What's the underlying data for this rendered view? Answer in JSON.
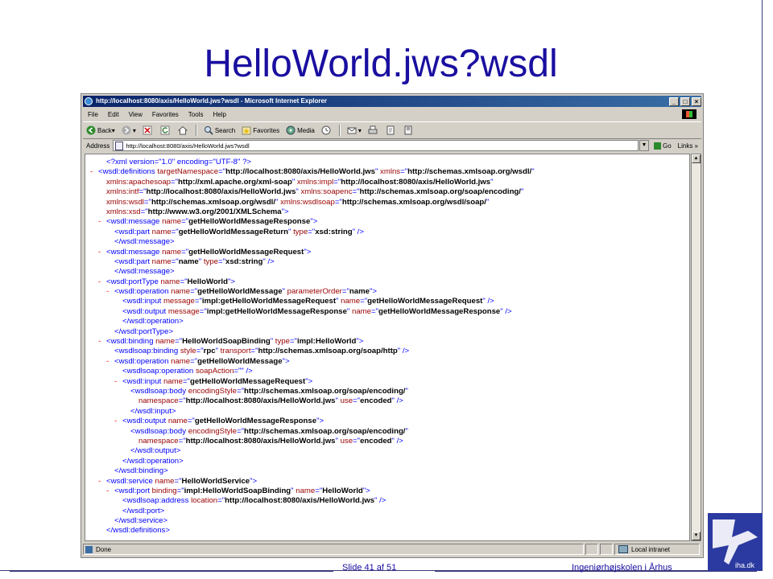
{
  "slide": {
    "title": "HelloWorld.jws?wsdl",
    "slide_number": "Slide 41 af  51",
    "organization": "Ingeniørhøjskolen i Århus",
    "logo_text": "iha.dk"
  },
  "browser": {
    "window_title": "http://localhost:8080/axis/HelloWorld.jws?wsdl - Microsoft Internet Explorer",
    "menu": [
      "File",
      "Edit",
      "View",
      "Favorites",
      "Tools",
      "Help"
    ],
    "toolbar": {
      "back": "Back",
      "search": "Search",
      "favorites": "Favorites",
      "media": "Media"
    },
    "address_label": "Address",
    "address_value": "http://localhost:8080/axis/HelloWorld.jws?wsdl",
    "go_label": "Go",
    "links_label": "Links",
    "status_text": "Done",
    "zone_text": "Local intranet"
  },
  "xml_lines": [
    {
      "indent": 1,
      "dash": false,
      "parts": [
        [
          "t",
          "<?xml version=\"1.0\" encoding=\"UTF-8\" ?>"
        ]
      ]
    },
    {
      "indent": 0,
      "dash": true,
      "parts": [
        [
          "t",
          "<wsdl:definitions "
        ],
        [
          "n",
          "targetNamespace"
        ],
        [
          "t",
          "=\""
        ],
        [
          "v",
          "http://localhost:8080/axis/HelloWorld.jws"
        ],
        [
          "t",
          "\" "
        ],
        [
          "n",
          "xmlns"
        ],
        [
          "t",
          "=\""
        ],
        [
          "v",
          "http://schemas.xmlsoap.org/wsdl/"
        ],
        [
          "t",
          "\""
        ]
      ]
    },
    {
      "indent": 1,
      "dash": false,
      "parts": [
        [
          "n",
          "xmlns:apachesoap"
        ],
        [
          "t",
          "=\""
        ],
        [
          "v",
          "http://xml.apache.org/xml-soap"
        ],
        [
          "t",
          "\" "
        ],
        [
          "n",
          "xmlns:impl"
        ],
        [
          "t",
          "=\""
        ],
        [
          "v",
          "http://localhost:8080/axis/HelloWorld.jws"
        ],
        [
          "t",
          "\""
        ]
      ]
    },
    {
      "indent": 1,
      "dash": false,
      "parts": [
        [
          "n",
          "xmlns:intf"
        ],
        [
          "t",
          "=\""
        ],
        [
          "v",
          "http://localhost:8080/axis/HelloWorld.jws"
        ],
        [
          "t",
          "\" "
        ],
        [
          "n",
          "xmlns:soapenc"
        ],
        [
          "t",
          "=\""
        ],
        [
          "v",
          "http://schemas.xmlsoap.org/soap/encoding/"
        ],
        [
          "t",
          "\""
        ]
      ]
    },
    {
      "indent": 1,
      "dash": false,
      "parts": [
        [
          "n",
          "xmlns:wsdl"
        ],
        [
          "t",
          "=\""
        ],
        [
          "v",
          "http://schemas.xmlsoap.org/wsdl/"
        ],
        [
          "t",
          "\" "
        ],
        [
          "n",
          "xmlns:wsdlsoap"
        ],
        [
          "t",
          "=\""
        ],
        [
          "v",
          "http://schemas.xmlsoap.org/wsdl/soap/"
        ],
        [
          "t",
          "\""
        ]
      ]
    },
    {
      "indent": 1,
      "dash": false,
      "parts": [
        [
          "n",
          "xmlns:xsd"
        ],
        [
          "t",
          "=\""
        ],
        [
          "v",
          "http://www.w3.org/2001/XMLSchema"
        ],
        [
          "t",
          "\">"
        ]
      ]
    },
    {
      "indent": 1,
      "dash": true,
      "parts": [
        [
          "t",
          "<wsdl:message "
        ],
        [
          "n",
          "name"
        ],
        [
          "t",
          "=\""
        ],
        [
          "v",
          "getHelloWorldMessageResponse"
        ],
        [
          "t",
          "\">"
        ]
      ]
    },
    {
      "indent": 2,
      "dash": false,
      "parts": [
        [
          "t",
          "<wsdl:part "
        ],
        [
          "n",
          "name"
        ],
        [
          "t",
          "=\""
        ],
        [
          "v",
          "getHelloWorldMessageReturn"
        ],
        [
          "t",
          "\" "
        ],
        [
          "n",
          "type"
        ],
        [
          "t",
          "=\""
        ],
        [
          "v",
          "xsd:string"
        ],
        [
          "t",
          "\" />"
        ]
      ]
    },
    {
      "indent": 2,
      "dash": false,
      "parts": [
        [
          "t",
          "</wsdl:message>"
        ]
      ]
    },
    {
      "indent": 1,
      "dash": true,
      "parts": [
        [
          "t",
          "<wsdl:message "
        ],
        [
          "n",
          "name"
        ],
        [
          "t",
          "=\""
        ],
        [
          "v",
          "getHelloWorldMessageRequest"
        ],
        [
          "t",
          "\">"
        ]
      ]
    },
    {
      "indent": 2,
      "dash": false,
      "parts": [
        [
          "t",
          "<wsdl:part "
        ],
        [
          "n",
          "name"
        ],
        [
          "t",
          "=\""
        ],
        [
          "v",
          "name"
        ],
        [
          "t",
          "\" "
        ],
        [
          "n",
          "type"
        ],
        [
          "t",
          "=\""
        ],
        [
          "v",
          "xsd:string"
        ],
        [
          "t",
          "\" />"
        ]
      ]
    },
    {
      "indent": 2,
      "dash": false,
      "parts": [
        [
          "t",
          "</wsdl:message>"
        ]
      ]
    },
    {
      "indent": 1,
      "dash": true,
      "parts": [
        [
          "t",
          "<wsdl:portType "
        ],
        [
          "n",
          "name"
        ],
        [
          "t",
          "=\""
        ],
        [
          "v",
          "HelloWorld"
        ],
        [
          "t",
          "\">"
        ]
      ]
    },
    {
      "indent": 2,
      "dash": true,
      "parts": [
        [
          "t",
          "<wsdl:operation "
        ],
        [
          "n",
          "name"
        ],
        [
          "t",
          "=\""
        ],
        [
          "v",
          "getHelloWorldMessage"
        ],
        [
          "t",
          "\" "
        ],
        [
          "n",
          "parameterOrder"
        ],
        [
          "t",
          "=\""
        ],
        [
          "v",
          "name"
        ],
        [
          "t",
          "\">"
        ]
      ]
    },
    {
      "indent": 3,
      "dash": false,
      "parts": [
        [
          "t",
          "<wsdl:input "
        ],
        [
          "n",
          "message"
        ],
        [
          "t",
          "=\""
        ],
        [
          "v",
          "impl:getHelloWorldMessageRequest"
        ],
        [
          "t",
          "\" "
        ],
        [
          "n",
          "name"
        ],
        [
          "t",
          "=\""
        ],
        [
          "v",
          "getHelloWorldMessageRequest"
        ],
        [
          "t",
          "\" />"
        ]
      ]
    },
    {
      "indent": 3,
      "dash": false,
      "parts": [
        [
          "t",
          "<wsdl:output "
        ],
        [
          "n",
          "message"
        ],
        [
          "t",
          "=\""
        ],
        [
          "v",
          "impl:getHelloWorldMessageResponse"
        ],
        [
          "t",
          "\" "
        ],
        [
          "n",
          "name"
        ],
        [
          "t",
          "=\""
        ],
        [
          "v",
          "getHelloWorldMessageResponse"
        ],
        [
          "t",
          "\" />"
        ]
      ]
    },
    {
      "indent": 3,
      "dash": false,
      "parts": [
        [
          "t",
          "</wsdl:operation>"
        ]
      ]
    },
    {
      "indent": 2,
      "dash": false,
      "parts": [
        [
          "t",
          "</wsdl:portType>"
        ]
      ]
    },
    {
      "indent": 1,
      "dash": true,
      "parts": [
        [
          "t",
          "<wsdl:binding "
        ],
        [
          "n",
          "name"
        ],
        [
          "t",
          "=\""
        ],
        [
          "v",
          "HelloWorldSoapBinding"
        ],
        [
          "t",
          "\" "
        ],
        [
          "n",
          "type"
        ],
        [
          "t",
          "=\""
        ],
        [
          "v",
          "impl:HelloWorld"
        ],
        [
          "t",
          "\">"
        ]
      ]
    },
    {
      "indent": 2,
      "dash": false,
      "parts": [
        [
          "t",
          "<wsdlsoap:binding "
        ],
        [
          "n",
          "style"
        ],
        [
          "t",
          "=\""
        ],
        [
          "v",
          "rpc"
        ],
        [
          "t",
          "\" "
        ],
        [
          "n",
          "transport"
        ],
        [
          "t",
          "=\""
        ],
        [
          "v",
          "http://schemas.xmlsoap.org/soap/http"
        ],
        [
          "t",
          "\" />"
        ]
      ]
    },
    {
      "indent": 2,
      "dash": true,
      "parts": [
        [
          "t",
          "<wsdl:operation "
        ],
        [
          "n",
          "name"
        ],
        [
          "t",
          "=\""
        ],
        [
          "v",
          "getHelloWorldMessage"
        ],
        [
          "t",
          "\">"
        ]
      ]
    },
    {
      "indent": 3,
      "dash": false,
      "parts": [
        [
          "t",
          "<wsdlsoap:operation "
        ],
        [
          "n",
          "soapAction"
        ],
        [
          "t",
          "=\"\" />"
        ]
      ]
    },
    {
      "indent": 3,
      "dash": true,
      "parts": [
        [
          "t",
          "<wsdl:input "
        ],
        [
          "n",
          "name"
        ],
        [
          "t",
          "=\""
        ],
        [
          "v",
          "getHelloWorldMessageRequest"
        ],
        [
          "t",
          "\">"
        ]
      ]
    },
    {
      "indent": 4,
      "dash": false,
      "parts": [
        [
          "t",
          "<wsdlsoap:body "
        ],
        [
          "n",
          "encodingStyle"
        ],
        [
          "t",
          "=\""
        ],
        [
          "v",
          "http://schemas.xmlsoap.org/soap/encoding/"
        ],
        [
          "t",
          "\""
        ]
      ]
    },
    {
      "indent": 5,
      "dash": false,
      "parts": [
        [
          "n",
          "namespace"
        ],
        [
          "t",
          "=\""
        ],
        [
          "v",
          "http://localhost:8080/axis/HelloWorld.jws"
        ],
        [
          "t",
          "\" "
        ],
        [
          "n",
          "use"
        ],
        [
          "t",
          "=\""
        ],
        [
          "v",
          "encoded"
        ],
        [
          "t",
          "\" />"
        ]
      ]
    },
    {
      "indent": 4,
      "dash": false,
      "parts": [
        [
          "t",
          "</wsdl:input>"
        ]
      ]
    },
    {
      "indent": 3,
      "dash": true,
      "parts": [
        [
          "t",
          "<wsdl:output "
        ],
        [
          "n",
          "name"
        ],
        [
          "t",
          "=\""
        ],
        [
          "v",
          "getHelloWorldMessageResponse"
        ],
        [
          "t",
          "\">"
        ]
      ]
    },
    {
      "indent": 4,
      "dash": false,
      "parts": [
        [
          "t",
          "<wsdlsoap:body "
        ],
        [
          "n",
          "encodingStyle"
        ],
        [
          "t",
          "=\""
        ],
        [
          "v",
          "http://schemas.xmlsoap.org/soap/encoding/"
        ],
        [
          "t",
          "\""
        ]
      ]
    },
    {
      "indent": 5,
      "dash": false,
      "parts": [
        [
          "n",
          "namespace"
        ],
        [
          "t",
          "=\""
        ],
        [
          "v",
          "http://localhost:8080/axis/HelloWorld.jws"
        ],
        [
          "t",
          "\" "
        ],
        [
          "n",
          "use"
        ],
        [
          "t",
          "=\""
        ],
        [
          "v",
          "encoded"
        ],
        [
          "t",
          "\" />"
        ]
      ]
    },
    {
      "indent": 4,
      "dash": false,
      "parts": [
        [
          "t",
          "</wsdl:output>"
        ]
      ]
    },
    {
      "indent": 3,
      "dash": false,
      "parts": [
        [
          "t",
          "</wsdl:operation>"
        ]
      ]
    },
    {
      "indent": 2,
      "dash": false,
      "parts": [
        [
          "t",
          "</wsdl:binding>"
        ]
      ]
    },
    {
      "indent": 1,
      "dash": true,
      "parts": [
        [
          "t",
          "<wsdl:service "
        ],
        [
          "n",
          "name"
        ],
        [
          "t",
          "=\""
        ],
        [
          "v",
          "HelloWorldService"
        ],
        [
          "t",
          "\">"
        ]
      ]
    },
    {
      "indent": 2,
      "dash": true,
      "parts": [
        [
          "t",
          "<wsdl:port "
        ],
        [
          "n",
          "binding"
        ],
        [
          "t",
          "=\""
        ],
        [
          "v",
          "impl:HelloWorldSoapBinding"
        ],
        [
          "t",
          "\" "
        ],
        [
          "n",
          "name"
        ],
        [
          "t",
          "=\""
        ],
        [
          "v",
          "HelloWorld"
        ],
        [
          "t",
          "\">"
        ]
      ]
    },
    {
      "indent": 3,
      "dash": false,
      "parts": [
        [
          "t",
          "<wsdlsoap:address "
        ],
        [
          "n",
          "location"
        ],
        [
          "t",
          "=\""
        ],
        [
          "v",
          "http://localhost:8080/axis/HelloWorld.jws"
        ],
        [
          "t",
          "\" />"
        ]
      ]
    },
    {
      "indent": 3,
      "dash": false,
      "parts": [
        [
          "t",
          "</wsdl:port>"
        ]
      ]
    },
    {
      "indent": 2,
      "dash": false,
      "parts": [
        [
          "t",
          "</wsdl:service>"
        ]
      ]
    },
    {
      "indent": 1,
      "dash": false,
      "parts": [
        [
          "t",
          "</wsdl:definitions>"
        ]
      ]
    }
  ]
}
